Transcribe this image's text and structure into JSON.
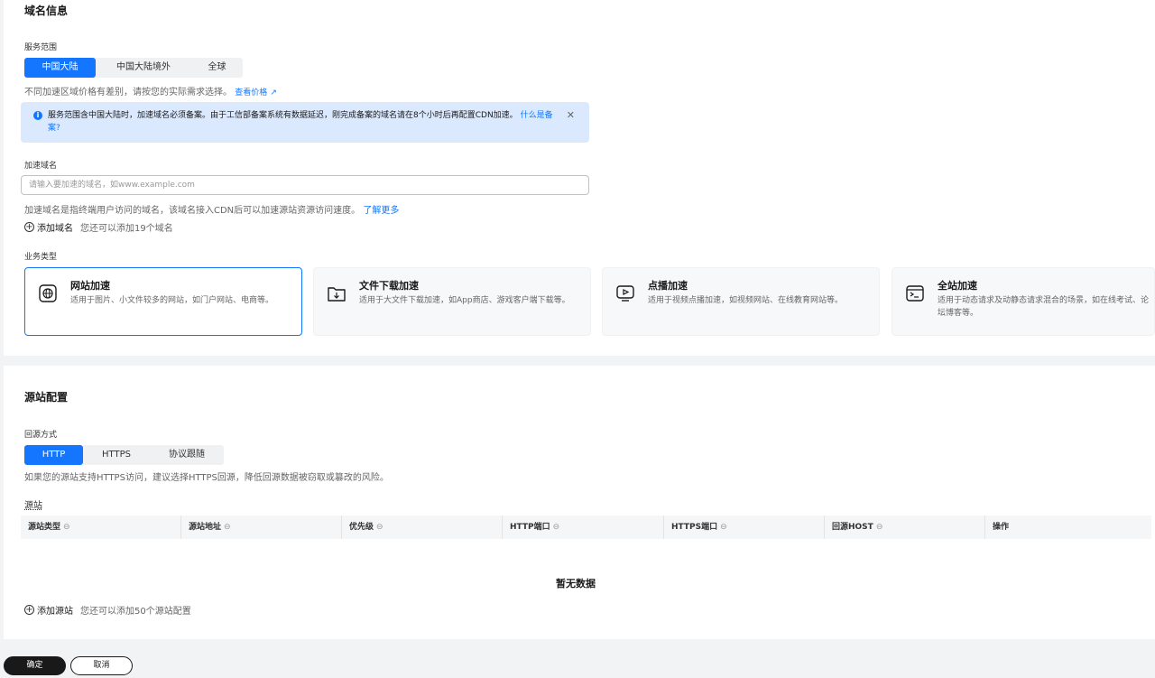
{
  "domain_section": {
    "title": "域名信息",
    "service_scope": {
      "label": "服务范围",
      "options": [
        "中国大陆",
        "中国大陆境外",
        "全球"
      ],
      "selected": "中国大陆"
    },
    "price_hint": "不同加速区域价格有差别，请按您的实际需求选择。",
    "price_link": "查看价格",
    "notice": {
      "text": "服务范围含中国大陆时，加速域名必须备案。由于工信部备案系统有数据延迟，刚完成备案的域名请在8个小时后再配置CDN加速。",
      "link": "什么是备案?"
    },
    "domain_name": {
      "label": "加速域名",
      "placeholder": "请输入要加速的域名，如www.example.com",
      "value": "",
      "hint": "加速域名是指终端用户访问的域名，该域名接入CDN后可以加速源站资源访问速度。",
      "learn_more": "了解更多"
    },
    "add_domain": {
      "label": "添加域名",
      "hint": "您还可以添加19个域名"
    },
    "business_type": {
      "label": "业务类型",
      "selected": "网站加速",
      "items": [
        {
          "title": "网站加速",
          "desc": "适用于图片、小文件较多的网站，如门户网站、电商等。",
          "icon": "globe-icon"
        },
        {
          "title": "文件下载加速",
          "desc": "适用于大文件下载加速，如App商店、游戏客户端下载等。",
          "icon": "folder-download-icon"
        },
        {
          "title": "点播加速",
          "desc": "适用于视频点播加速，如视频网站、在线教育网站等。",
          "icon": "video-play-icon"
        },
        {
          "title": "全站加速",
          "desc": "适用于动态请求及动静态请求混合的场景，如在线考试、论坛博客等。",
          "icon": "terminal-icon"
        }
      ]
    }
  },
  "origin_section": {
    "title": "源站配置",
    "back_source": {
      "label": "回源方式",
      "options": [
        "HTTP",
        "HTTPS",
        "协议跟随"
      ],
      "selected": "HTTP",
      "hint": "如果您的源站支持HTTPS访问，建议选择HTTPS回源，降低回源数据被窃取或篡改的风险。"
    },
    "origin_label": "源站",
    "table": {
      "columns": [
        "源站类型",
        "源站地址",
        "优先级",
        "HTTP端口",
        "HTTPS端口",
        "回源HOST",
        "操作"
      ],
      "sortable": [
        true,
        true,
        true,
        true,
        true,
        true,
        false
      ],
      "sort_glyph": "⊖",
      "empty_text": "暂无数据"
    },
    "add_origin": {
      "label": "添加源站",
      "hint": "您还可以添加50个源站配置"
    }
  },
  "footer": {
    "confirm": "确定",
    "cancel": "取消"
  },
  "colors": {
    "accent": "#1476ff",
    "notice_bg": "#dbe9ff",
    "primary_button": "#191919"
  }
}
